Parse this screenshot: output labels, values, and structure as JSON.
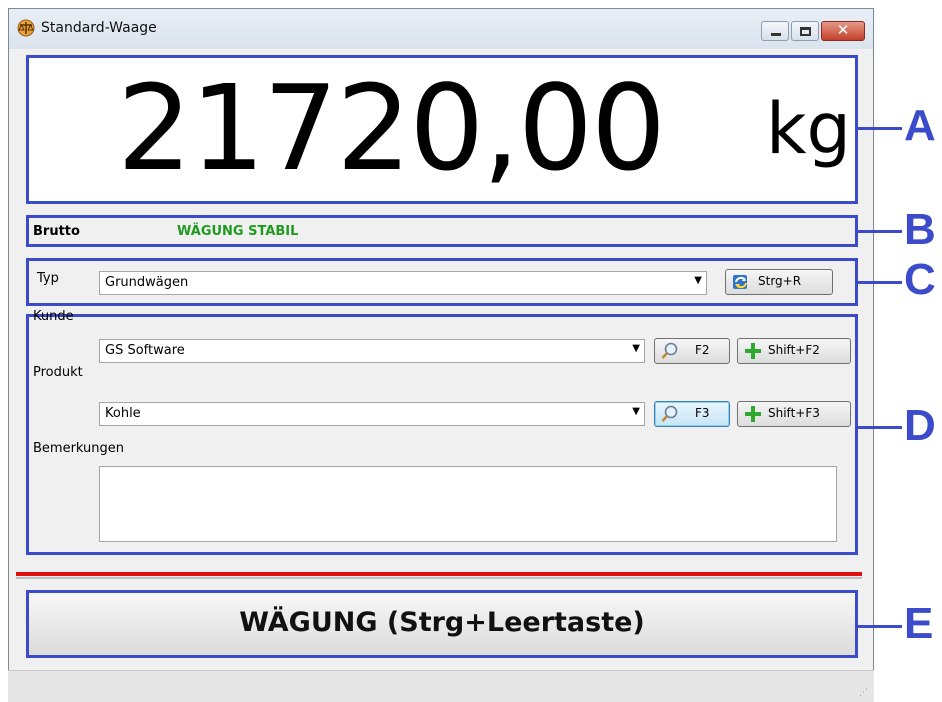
{
  "window": {
    "title": "Standard-Waage"
  },
  "weight": {
    "value": "21720,00",
    "unit": "kg"
  },
  "status": {
    "mode": "Brutto",
    "state": "WÄGUNG STABIL",
    "state_color": "#1f9a1f"
  },
  "type_row": {
    "label": "Typ",
    "value": "Grundwägen",
    "button": "Strg+R"
  },
  "customer": {
    "label": "Kunde",
    "value": "GS Software",
    "search_button": "F2",
    "add_button": "Shift+F2"
  },
  "product": {
    "label": "Produkt",
    "value": "Kohle",
    "search_button": "F3",
    "add_button": "Shift+F3"
  },
  "remarks": {
    "label": "Bemerkungen",
    "value": ""
  },
  "action": {
    "label": "WÄGUNG (Strg+Leertaste)"
  },
  "callouts": [
    "A",
    "B",
    "C",
    "D",
    "E"
  ],
  "colors": {
    "annotation": "#3c4bc9",
    "accent_line": "#e01010"
  }
}
